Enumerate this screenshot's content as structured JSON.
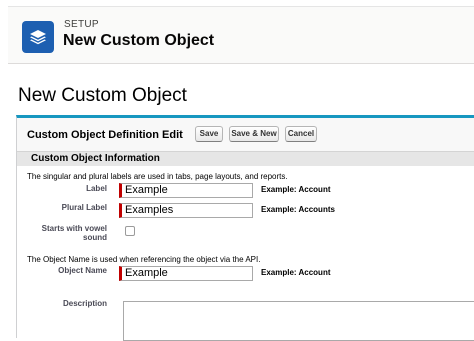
{
  "header": {
    "kicker": "SETUP",
    "title": "New Custom Object",
    "icon": "layers-icon",
    "icon_color": "#1d5fb1"
  },
  "page_title": "New Custom Object",
  "panel": {
    "title": "Custom Object Definition Edit",
    "buttons": {
      "save": "Save",
      "save_new": "Save & New",
      "cancel": "Cancel"
    },
    "section_title": "Custom Object Information",
    "accent_color": "#1797c0",
    "required_color": "#c00000"
  },
  "form": {
    "labels_help": "The singular and plural labels are used in tabs, page layouts, and reports.",
    "label": {
      "label": "Label",
      "value": "Example",
      "example": "Example:  Account"
    },
    "plural": {
      "label": "Plural Label",
      "value": "Examples",
      "example": "Example:  Accounts"
    },
    "vowel": {
      "label_line1": "Starts with vowel",
      "label_line2": "sound",
      "checked": false
    },
    "name_help": "The Object Name is used when referencing the object via the API.",
    "object_name": {
      "label": "Object Name",
      "value": "Example",
      "example": "Example:  Account"
    },
    "description": {
      "label": "Description",
      "value": ""
    }
  }
}
